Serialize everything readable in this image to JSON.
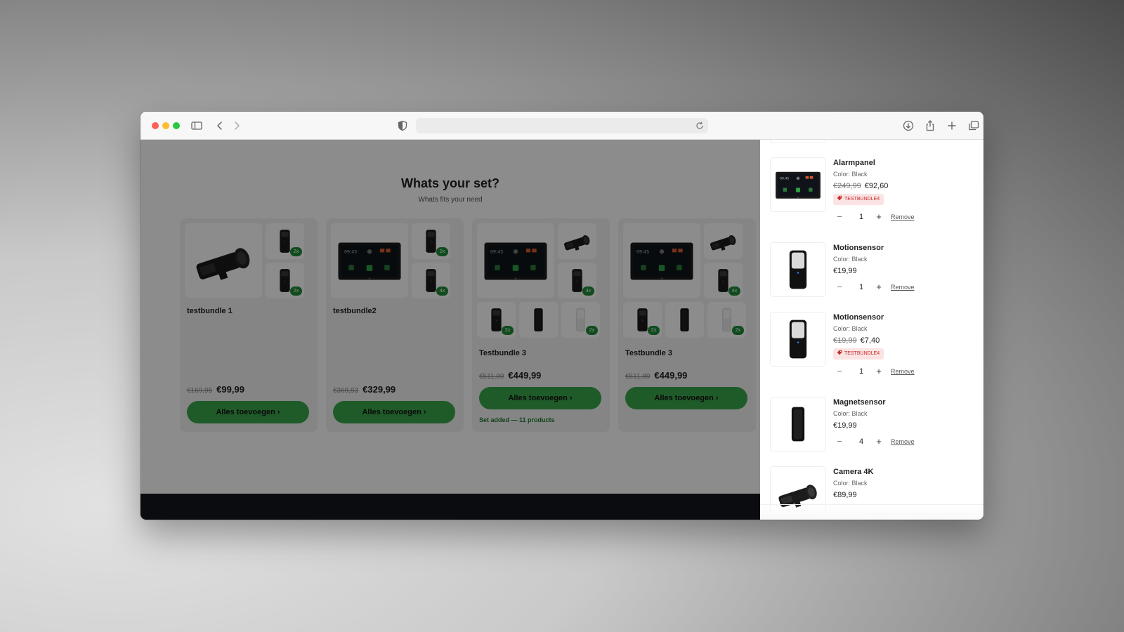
{
  "browser": {
    "icons": {
      "sidebar": "sidebar-icon",
      "back": "chevron-left-icon",
      "forward": "chevron-right-icon",
      "privacy": "shield-icon",
      "reload": "reload-icon",
      "download": "download-icon",
      "share": "share-icon",
      "new_tab": "plus-icon",
      "tabs": "tabs-overview-icon"
    },
    "traffic_lights": [
      "#fe5f57",
      "#febc2e",
      "#28c840"
    ],
    "address_value": ""
  },
  "page": {
    "title": "Whats your set?",
    "subtitle": "Whats fits your need",
    "accent_color": "#3aa64c",
    "bundles": [
      {
        "name": "testbundle 1",
        "price_old": "€169,95",
        "price_new": "€99,99",
        "button_label": "Alles toevoegen ›",
        "tiles": [
          {
            "product": "camera",
            "badge": ""
          },
          {
            "product": "keypad",
            "badge": "2x"
          },
          {
            "product": "keypad",
            "badge": "2x"
          }
        ]
      },
      {
        "name": "testbundle2",
        "price_old": "€369,93",
        "price_new": "€329,99",
        "button_label": "Alles toevoegen ›",
        "tiles": [
          {
            "product": "alarmpanel",
            "badge": ""
          },
          {
            "product": "keypad",
            "badge": "2x"
          },
          {
            "product": "keypad",
            "badge": "4x"
          }
        ]
      },
      {
        "name": "Testbundle 3",
        "price_old": "€511,89",
        "price_new": "€449,99",
        "button_label": "Alles toevoegen ›",
        "status": "Set added — 11 products",
        "tiles": [
          {
            "product": "alarmpanel",
            "badge": ""
          },
          {
            "product": "camera",
            "badge": ""
          },
          {
            "product": "keypad",
            "badge": "4x"
          },
          {
            "product": "keypad",
            "badge": "2x"
          },
          {
            "product": "magnet",
            "badge": ""
          },
          {
            "product": "motion-white",
            "badge": "2x"
          }
        ]
      },
      {
        "name": "Testbundle 3",
        "price_old": "€511,89",
        "price_new": "€449,99",
        "button_label": "Alles toevoegen ›",
        "tiles": [
          {
            "product": "alarmpanel",
            "badge": ""
          },
          {
            "product": "camera",
            "badge": ""
          },
          {
            "product": "keypad",
            "badge": "4x"
          },
          {
            "product": "keypad",
            "badge": "2x"
          },
          {
            "product": "magnet",
            "badge": ""
          },
          {
            "product": "motion-white",
            "badge": "2x"
          }
        ]
      }
    ]
  },
  "cart": {
    "items": [
      {
        "name": "Alarmpanel",
        "color": "Color: Black",
        "price_old": "€249,99",
        "price": "€92,60",
        "discount": "TESTBUNDLE4",
        "quantity": "1",
        "remove_label": "Remove",
        "product": "alarmpanel"
      },
      {
        "name": "Motionsensor",
        "color": "Color: Black",
        "price_old": "",
        "price": "€19,99",
        "discount": "",
        "quantity": "1",
        "remove_label": "Remove",
        "product": "motion"
      },
      {
        "name": "Motionsensor",
        "color": "Color: Black",
        "price_old": "€19,99",
        "price": "€7,40",
        "discount": "TESTBUNDLE4",
        "quantity": "1",
        "remove_label": "Remove",
        "product": "motion"
      },
      {
        "name": "Magnetsensor",
        "color": "Color: Black",
        "price_old": "",
        "price": "€19,99",
        "discount": "",
        "quantity": "4",
        "remove_label": "Remove",
        "product": "magnet"
      },
      {
        "name": "Camera 4K",
        "color": "Color: Black",
        "price_old": "",
        "price": "€89,99",
        "discount": "",
        "quantity": "",
        "remove_label": "",
        "product": "camera"
      }
    ],
    "qty_minus": "−",
    "qty_plus": "+",
    "discount_color": "#c62828"
  }
}
